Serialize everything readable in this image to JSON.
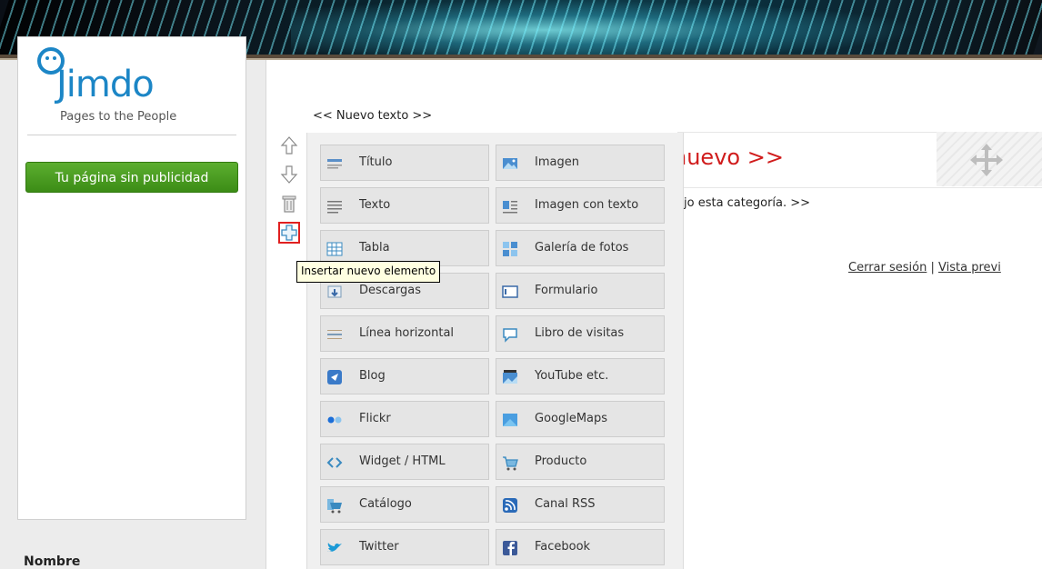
{
  "sidebar": {
    "logo_text": "Jimdo",
    "tagline": "Pages to the People",
    "promo_button": "Tu página sin publicidad",
    "nombre_label": "Nombre"
  },
  "content": {
    "new_text_placeholder": "<< Nuevo texto >>",
    "heading": "nuevo >>",
    "category_text": "jo esta categoría. >>",
    "logout_link": "Cerrar sesión",
    "separator": "|",
    "preview_link": "Vista previ"
  },
  "toolbar": {
    "tooltip": "Insertar nuevo elemento",
    "icons": [
      "arrow-up-icon",
      "arrow-down-icon",
      "trash-icon",
      "add-element-icon"
    ]
  },
  "insert_menu": {
    "left": [
      {
        "label": "Título",
        "icon": "title-icon"
      },
      {
        "label": "Texto",
        "icon": "text-icon"
      },
      {
        "label": "Tabla",
        "icon": "table-icon"
      },
      {
        "label": "Descargas",
        "icon": "download-icon"
      },
      {
        "label": "Línea horizontal",
        "icon": "horizontal-line-icon"
      },
      {
        "label": "Blog",
        "icon": "blog-icon"
      },
      {
        "label": "Flickr",
        "icon": "flickr-icon"
      },
      {
        "label": "Widget / HTML",
        "icon": "widget-html-icon"
      },
      {
        "label": "Catálogo",
        "icon": "catalog-icon"
      },
      {
        "label": "Twitter",
        "icon": "twitter-icon"
      }
    ],
    "right": [
      {
        "label": "Imagen",
        "icon": "image-icon"
      },
      {
        "label": "Imagen con texto",
        "icon": "image-with-text-icon"
      },
      {
        "label": "Galería de fotos",
        "icon": "photo-gallery-icon"
      },
      {
        "label": "Formulario",
        "icon": "form-icon"
      },
      {
        "label": "Libro de visitas",
        "icon": "guestbook-icon"
      },
      {
        "label": "YouTube etc.",
        "icon": "youtube-icon"
      },
      {
        "label": "GoogleMaps",
        "icon": "google-maps-icon"
      },
      {
        "label": "Producto",
        "icon": "product-icon"
      },
      {
        "label": "Canal RSS",
        "icon": "rss-icon"
      },
      {
        "label": "Facebook",
        "icon": "facebook-icon"
      }
    ]
  },
  "colors": {
    "promo_green": "#4a9e22",
    "heading_red": "#d01c1c",
    "logo_blue": "#1c86c6",
    "tooltip_bg": "#ffffe1"
  }
}
